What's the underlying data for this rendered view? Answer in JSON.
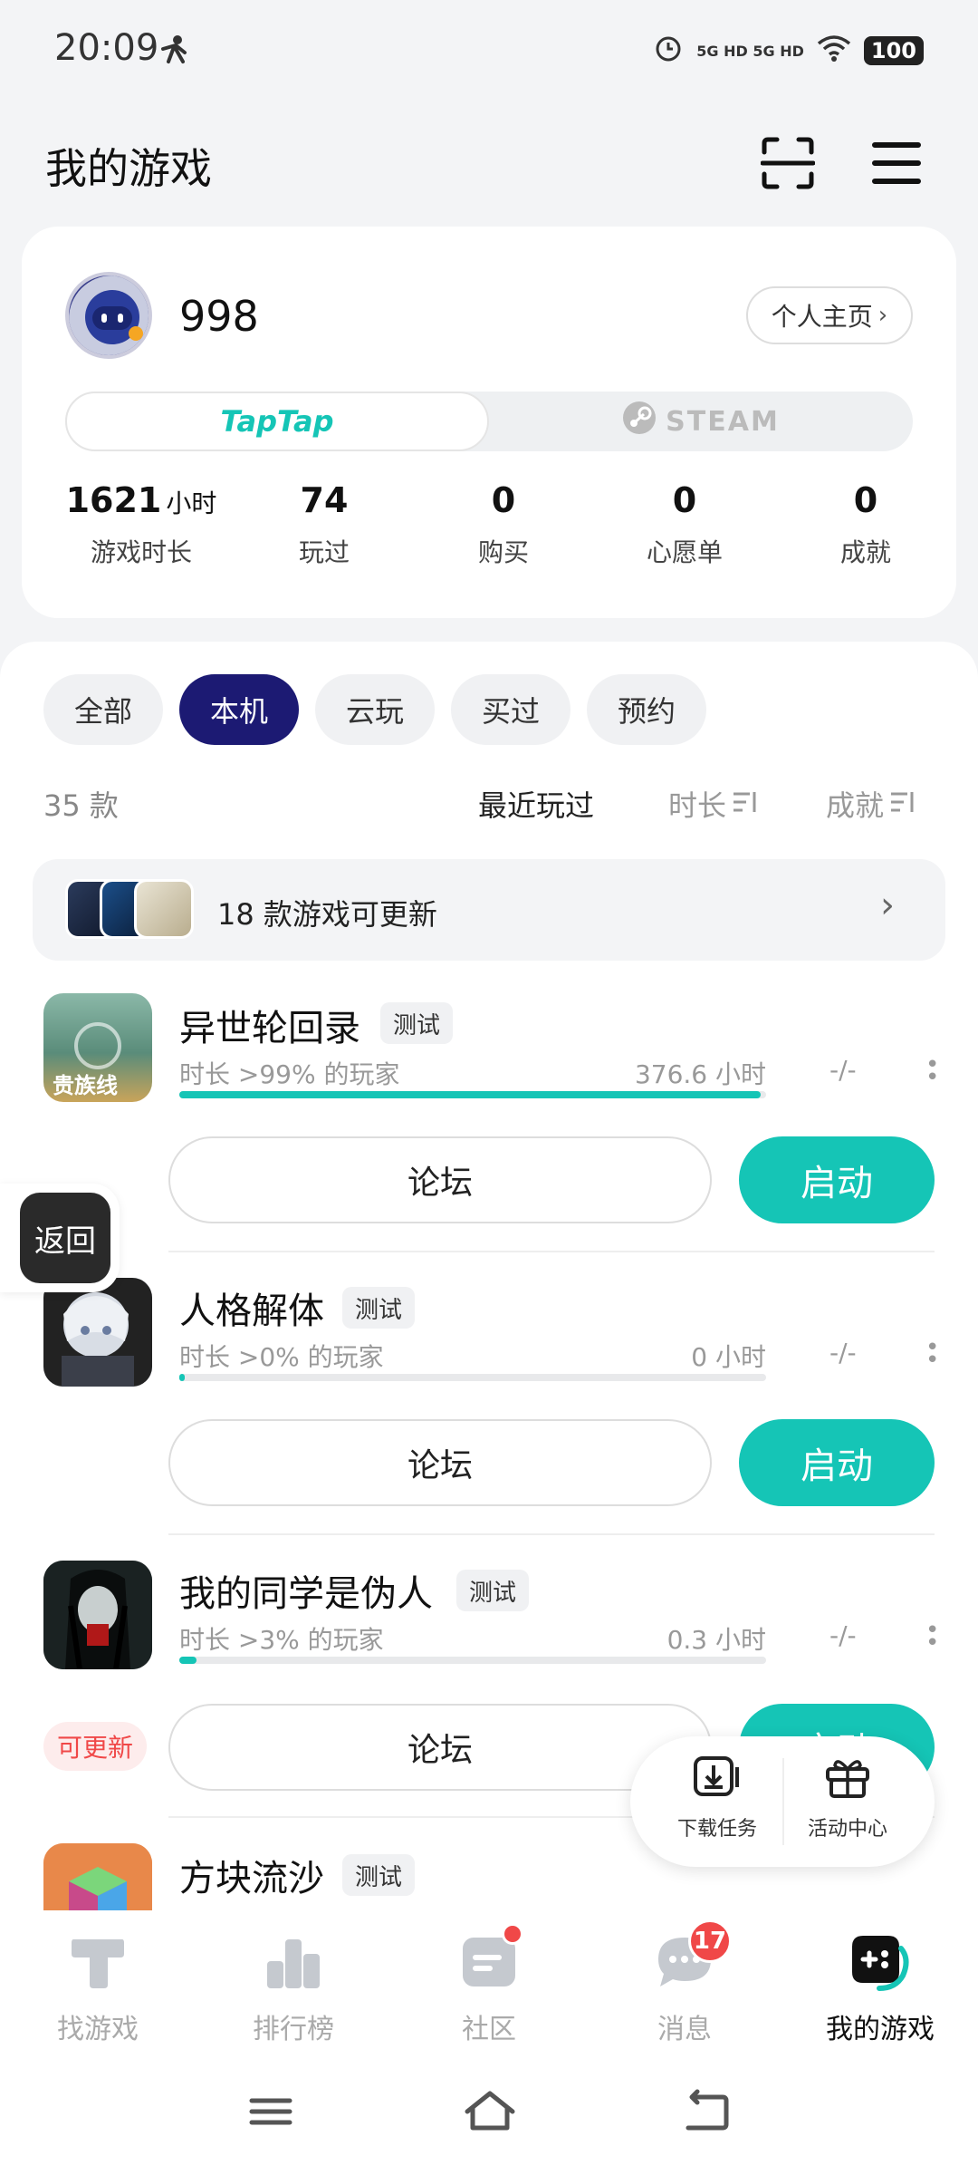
{
  "status_bar": {
    "time": "20:09",
    "network": "5G HD 5G HD",
    "battery": "100"
  },
  "header": {
    "title": "我的游戏"
  },
  "profile": {
    "username": "998",
    "profile_button": "个人主页",
    "platforms": [
      "TapTap",
      "STEAM"
    ],
    "stats": [
      {
        "value": "1621",
        "unit": "小时",
        "label": "游戏时长"
      },
      {
        "value": "74",
        "unit": "",
        "label": "玩过"
      },
      {
        "value": "0",
        "unit": "",
        "label": "购买"
      },
      {
        "value": "0",
        "unit": "",
        "label": "心愿单"
      },
      {
        "value": "0",
        "unit": "",
        "label": "成就"
      }
    ]
  },
  "filters": [
    "全部",
    "本机",
    "云玩",
    "买过",
    "预约"
  ],
  "active_filter": "本机",
  "list_header": {
    "count": "35 款",
    "sort_options": [
      "最近玩过",
      "时长",
      "成就"
    ]
  },
  "update_banner": {
    "text": "18 款游戏可更新"
  },
  "games": [
    {
      "title": "异世轮回录",
      "tag": "测试",
      "playtime_text": "时长 >99% 的玩家",
      "hours": "376.6 小时",
      "progress": 0.99,
      "achievement": "-/-",
      "forum": "论坛",
      "launch": "启动",
      "icon_text": "贵族线"
    },
    {
      "title": "人格解体",
      "tag": "测试",
      "playtime_text": "时长 >0% 的玩家",
      "hours": "0 小时",
      "progress": 0.005,
      "achievement": "-/-",
      "forum": "论坛",
      "launch": "启动"
    },
    {
      "title": "我的同学是伪人",
      "tag": "测试",
      "playtime_text": "时长 >3% 的玩家",
      "hours": "0.3 小时",
      "progress": 0.03,
      "achievement": "-/-",
      "forum": "论坛",
      "launch": "启动",
      "update_badge": "可更新"
    },
    {
      "title": "方块流沙",
      "tag": "测试"
    }
  ],
  "back_button": "返回",
  "float_menu": [
    "下载任务",
    "活动中心"
  ],
  "bottom_nav": [
    {
      "label": "找游戏",
      "icon": "find-games-icon"
    },
    {
      "label": "排行榜",
      "icon": "ranking-icon"
    },
    {
      "label": "社区",
      "icon": "community-icon"
    },
    {
      "label": "消息",
      "icon": "messages-icon",
      "badge": "17"
    },
    {
      "label": "我的游戏",
      "icon": "my-games-icon",
      "active": true
    }
  ],
  "colors": {
    "accent": "#15c5b6",
    "active_chip": "#1c1a73",
    "badge": "#f04848"
  }
}
